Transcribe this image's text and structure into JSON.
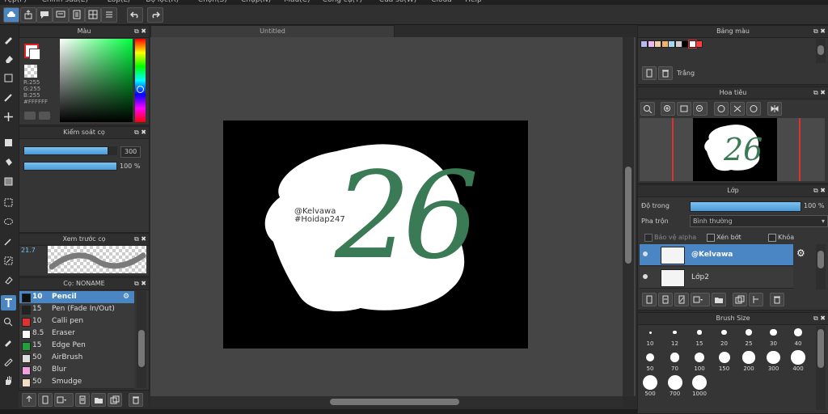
{
  "menu": [
    "Tệp(F)",
    "Chỉnh sửa(E)",
    "Lớp(L)",
    "Bộ lọc(R)",
    "Chọn(S)",
    "Chụp(N)",
    "Mẫu(C)",
    "Công cụ(T)",
    "Cửa sổ(W)",
    "Cloud",
    "Help"
  ],
  "canvas": {
    "tab_title": "Untitled",
    "watermark_line1": "@Kelvawa",
    "watermark_line2": "#Hoidap247",
    "art_text": "26",
    "art_color": "#3a7a55"
  },
  "color_panel": {
    "title": "Màu",
    "r": "R:255",
    "g": "G:255",
    "b": "B:255",
    "hex": "#FFFFFF"
  },
  "brush_control": {
    "title": "Kiểm soát cọ",
    "size": "300",
    "opacity": "100 %",
    "size_fraction": 0.9,
    "opacity_fraction": 1.0
  },
  "brush_preview": {
    "title": "Xem trước cọ",
    "size_label": "21.7"
  },
  "brush_list": {
    "title": "Cọ: NONAME",
    "items": [
      {
        "size": "10",
        "name": "Pencil",
        "color": "#111111",
        "selected": true
      },
      {
        "size": "15",
        "name": "Pen (Fade In/Out)",
        "color": "#222222"
      },
      {
        "size": "10",
        "name": "Calli pen",
        "color": "#e03030"
      },
      {
        "size": "8.5",
        "name": "Eraser",
        "color": "#ffffff"
      },
      {
        "size": "15",
        "name": "Edge Pen",
        "color": "#22a040"
      },
      {
        "size": "50",
        "name": "AirBrush",
        "color": "#dddddd"
      },
      {
        "size": "80",
        "name": "Blur",
        "color": "#f0a0e0"
      },
      {
        "size": "50",
        "name": "Smudge",
        "color": "#f5ddc5"
      }
    ]
  },
  "palette": {
    "title": "Bảng màu",
    "current_name": "Trắng",
    "colors": [
      "#b8b8f0",
      "#f0b8f0",
      "#f0d0a8",
      "#f0b070",
      "#a8d8f0",
      "#d0d0d0",
      "#000000",
      "#ffffff",
      "#ff4040"
    ]
  },
  "navigator": {
    "title": "Hoa tiêu"
  },
  "layers": {
    "title": "Lớp",
    "opacity_label": "Độ trong",
    "opacity_value": "100 %",
    "blend_label": "Pha trộn",
    "blend_value": "Bình thường",
    "protect_alpha": "Bảo vệ alpha",
    "clipping": "Xén bớt",
    "lock": "Khóa",
    "items": [
      {
        "name": "@Kelvawa",
        "selected": true
      },
      {
        "name": "Lớp2",
        "selected": false
      }
    ]
  },
  "brush_size": {
    "title": "Brush Size",
    "sizes": [
      "10",
      "12",
      "15",
      "20",
      "25",
      "30",
      "40",
      "50",
      "70",
      "100",
      "150",
      "200",
      "300",
      "400",
      "500",
      "700",
      "1000"
    ]
  }
}
